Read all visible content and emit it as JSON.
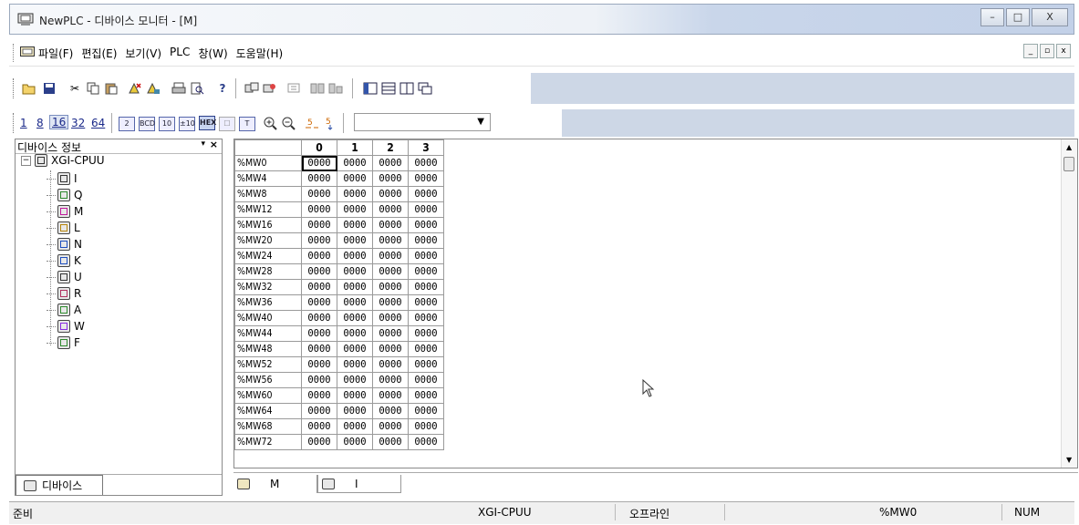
{
  "window": {
    "title": "NewPLC - 디바이스 모니터 - [M]",
    "buttons": [
      "–",
      "□",
      "X"
    ]
  },
  "menu": {
    "items": [
      "파일(F)",
      "편집(E)",
      "보기(V)",
      "PLC",
      "창(W)",
      "도움말(H)"
    ],
    "mdi_buttons": [
      "_",
      "▫",
      "x"
    ]
  },
  "toolbar2": {
    "num_formats": [
      "1",
      "8",
      "16",
      "32",
      "64"
    ],
    "active_format": "16",
    "format_icons": [
      "2",
      "BCD",
      "10",
      "±10",
      "HEX",
      "☐",
      "T"
    ],
    "combo_value": ""
  },
  "left_panel": {
    "title": "디바이스 정보",
    "root": "XGI-CPUU",
    "devices": [
      {
        "label": "I",
        "color": "#333333"
      },
      {
        "label": "Q",
        "color": "#2e8b2e"
      },
      {
        "label": "M",
        "color": "#c0199a"
      },
      {
        "label": "L",
        "color": "#b8860b"
      },
      {
        "label": "N",
        "color": "#1e4fbf"
      },
      {
        "label": "K",
        "color": "#1e4fbf"
      },
      {
        "label": "U",
        "color": "#333333"
      },
      {
        "label": "R",
        "color": "#b03060"
      },
      {
        "label": "A",
        "color": "#2e8b2e"
      },
      {
        "label": "W",
        "color": "#8a2be2"
      },
      {
        "label": "F",
        "color": "#2e8b2e"
      }
    ],
    "tab_label": "디바이스"
  },
  "monitor": {
    "columns": [
      "0",
      "1",
      "2",
      "3"
    ],
    "rows": [
      {
        "addr": "%MW0",
        "values": [
          "0000",
          "0000",
          "0000",
          "0000"
        ]
      },
      {
        "addr": "%MW4",
        "values": [
          "0000",
          "0000",
          "0000",
          "0000"
        ]
      },
      {
        "addr": "%MW8",
        "values": [
          "0000",
          "0000",
          "0000",
          "0000"
        ]
      },
      {
        "addr": "%MW12",
        "values": [
          "0000",
          "0000",
          "0000",
          "0000"
        ]
      },
      {
        "addr": "%MW16",
        "values": [
          "0000",
          "0000",
          "0000",
          "0000"
        ]
      },
      {
        "addr": "%MW20",
        "values": [
          "0000",
          "0000",
          "0000",
          "0000"
        ]
      },
      {
        "addr": "%MW24",
        "values": [
          "0000",
          "0000",
          "0000",
          "0000"
        ]
      },
      {
        "addr": "%MW28",
        "values": [
          "0000",
          "0000",
          "0000",
          "0000"
        ]
      },
      {
        "addr": "%MW32",
        "values": [
          "0000",
          "0000",
          "0000",
          "0000"
        ]
      },
      {
        "addr": "%MW36",
        "values": [
          "0000",
          "0000",
          "0000",
          "0000"
        ]
      },
      {
        "addr": "%MW40",
        "values": [
          "0000",
          "0000",
          "0000",
          "0000"
        ]
      },
      {
        "addr": "%MW44",
        "values": [
          "0000",
          "0000",
          "0000",
          "0000"
        ]
      },
      {
        "addr": "%MW48",
        "values": [
          "0000",
          "0000",
          "0000",
          "0000"
        ]
      },
      {
        "addr": "%MW52",
        "values": [
          "0000",
          "0000",
          "0000",
          "0000"
        ]
      },
      {
        "addr": "%MW56",
        "values": [
          "0000",
          "0000",
          "0000",
          "0000"
        ]
      },
      {
        "addr": "%MW60",
        "values": [
          "0000",
          "0000",
          "0000",
          "0000"
        ]
      },
      {
        "addr": "%MW64",
        "values": [
          "0000",
          "0000",
          "0000",
          "0000"
        ]
      },
      {
        "addr": "%MW68",
        "values": [
          "0000",
          "0000",
          "0000",
          "0000"
        ]
      },
      {
        "addr": "%MW72",
        "values": [
          "0000",
          "0000",
          "0000",
          "0000"
        ]
      }
    ]
  },
  "doc_tabs": [
    "M",
    "I"
  ],
  "status": {
    "ready": "준비",
    "cpu": "XGI-CPUU",
    "mode": "오프라인",
    "address": "%MW0",
    "num": "NUM"
  }
}
